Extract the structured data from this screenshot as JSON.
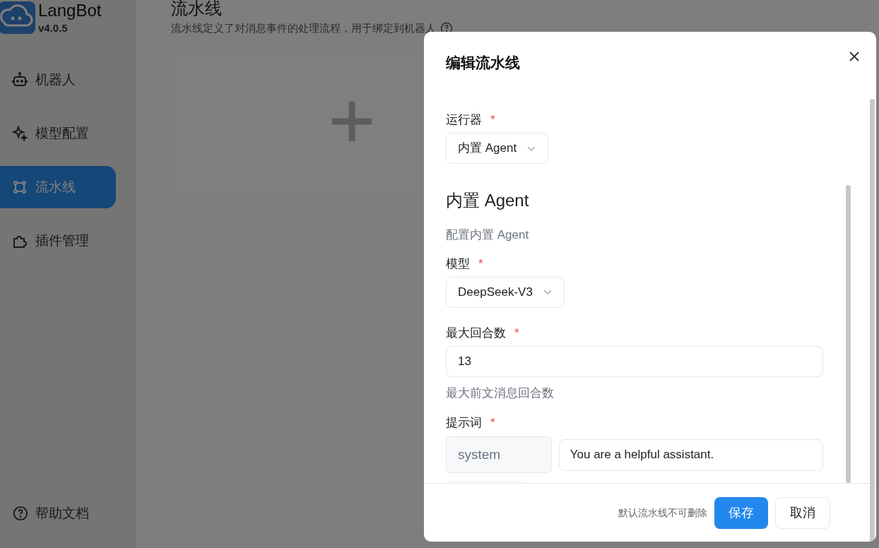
{
  "app": {
    "name": "LangBot",
    "version": "v4.0.5"
  },
  "sidebar": {
    "items": [
      {
        "label": "机器人",
        "kind": "robot",
        "selected": false
      },
      {
        "label": "模型配置",
        "kind": "sparkle",
        "selected": false
      },
      {
        "label": "流水线",
        "kind": "pipeline",
        "selected": true
      },
      {
        "label": "插件管理",
        "kind": "plugin",
        "selected": false
      }
    ],
    "footer_item": {
      "label": "帮助文档"
    }
  },
  "page": {
    "title": "流水线",
    "description": "流水线定义了对消息事件的处理流程，用于绑定到机器人"
  },
  "dialog": {
    "title": "编辑流水线",
    "fields": [
      {
        "kind": "select",
        "label": "运行器",
        "required_mark": "*",
        "value": "内置 Agent"
      },
      {
        "kind": "section",
        "title": "内置 Agent",
        "description": "配置内置 Agent"
      },
      {
        "kind": "select",
        "label": "模型",
        "required_mark": "*",
        "value": "DeepSeek-V3"
      },
      {
        "kind": "input",
        "label": "最大回合数",
        "required_mark": "*",
        "value": "13",
        "help": "最大前文消息回合数"
      },
      {
        "kind": "prompt",
        "label": "提示词",
        "required_mark": "*",
        "messages": [
          {
            "role": "system",
            "content": "You are a helpful assistant."
          }
        ]
      }
    ],
    "footer_note": "默认流水线不可删除",
    "buttons": [
      {
        "label": "保存",
        "kind": "primary"
      },
      {
        "label": "取消",
        "kind": "secondary"
      }
    ]
  }
}
